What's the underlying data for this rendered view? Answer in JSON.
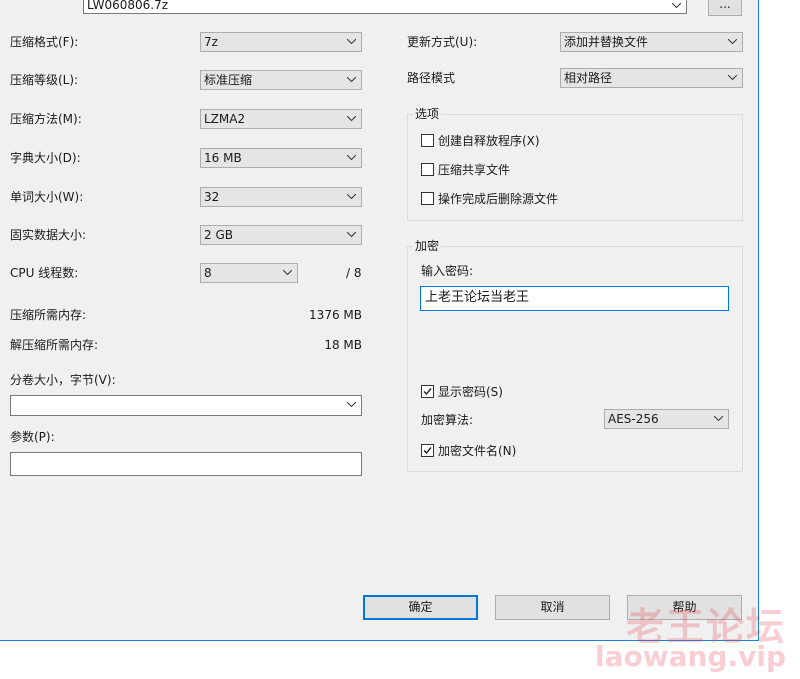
{
  "archive": {
    "filename": "LW060806.7z",
    "browse_label": "..."
  },
  "left": {
    "format": {
      "label": "压缩格式(F):",
      "value": "7z"
    },
    "level": {
      "label": "压缩等级(L):",
      "value": "标准压缩"
    },
    "method": {
      "label": "压缩方法(M):",
      "value": "LZMA2"
    },
    "dict": {
      "label": "字典大小(D):",
      "value": "16 MB"
    },
    "word": {
      "label": "单词大小(W):",
      "value": "32"
    },
    "solid": {
      "label": "固实数据大小:",
      "value": "2 GB"
    },
    "threads": {
      "label": "CPU 线程数:",
      "value": "8",
      "max": "/ 8"
    },
    "mem_compress": {
      "label": "压缩所需内存:",
      "value": "1376 MB"
    },
    "mem_decompress": {
      "label": "解压缩所需内存:",
      "value": "18 MB"
    },
    "volume": {
      "label": "分卷大小，字节(V):",
      "value": ""
    },
    "params": {
      "label": "参数(P):",
      "value": ""
    }
  },
  "right": {
    "update": {
      "label": "更新方式(U):",
      "value": "添加并替换文件"
    },
    "path": {
      "label": "路径模式",
      "value": "相对路径"
    },
    "options": {
      "title": "选项",
      "sfx": {
        "label": "创建自释放程序(X)",
        "checked": false
      },
      "shared": {
        "label": "压缩共享文件",
        "checked": false
      },
      "delete": {
        "label": "操作完成后删除源文件",
        "checked": false
      }
    },
    "encryption": {
      "title": "加密",
      "password_label": "输入密码:",
      "password_value": "上老王论坛当老王",
      "show_password": {
        "label": "显示密码(S)",
        "checked": true
      },
      "method_label": "加密算法:",
      "method_value": "AES-256",
      "encrypt_names": {
        "label": "加密文件名(N)",
        "checked": true
      }
    }
  },
  "buttons": {
    "ok": "确定",
    "cancel": "取消",
    "help": "帮助"
  },
  "watermark": {
    "cn": "老王论坛",
    "en": "laowang.vip"
  },
  "colors": {
    "dialog_bg": "#f0f0f0",
    "focus_blue": "#0078d7",
    "watermark": "#e63c50"
  }
}
